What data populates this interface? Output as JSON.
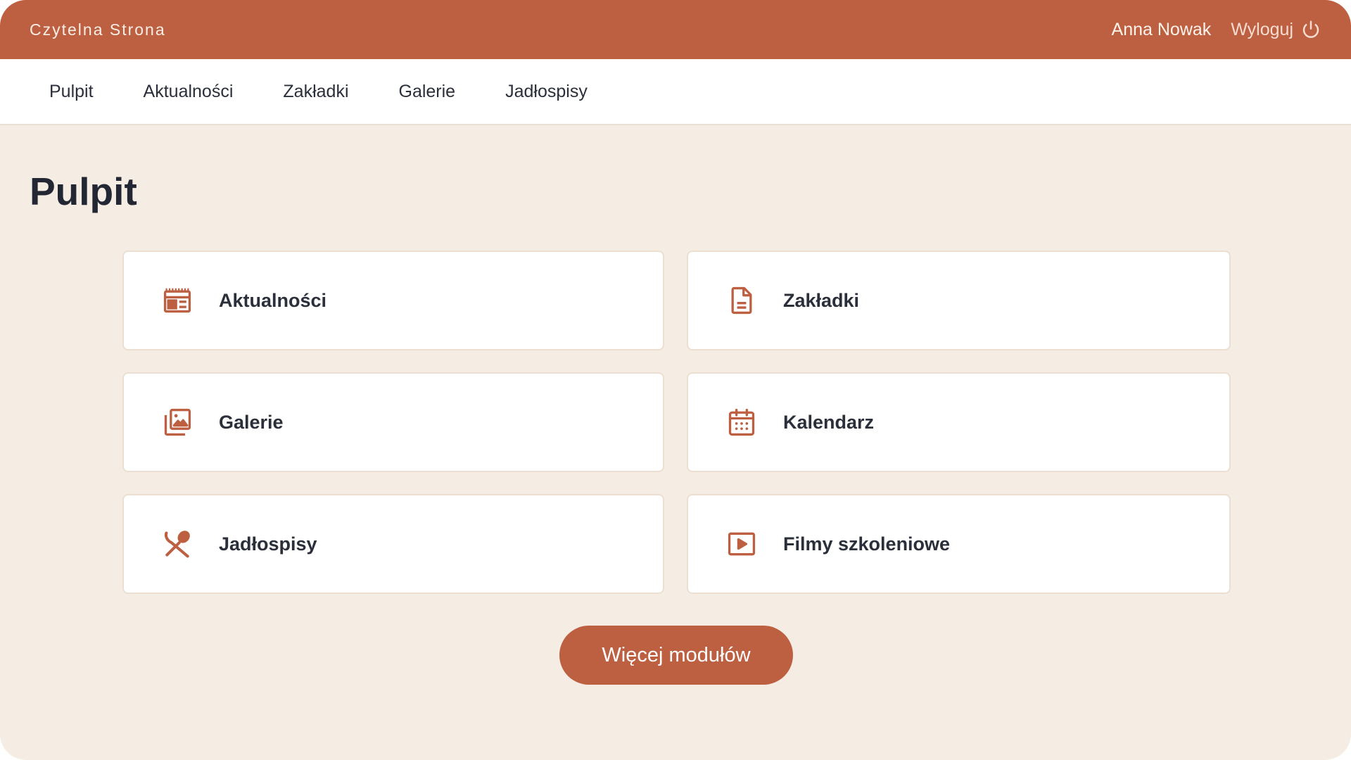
{
  "header": {
    "brand": "Czytelna Strona",
    "user_name": "Anna Nowak",
    "logout_label": "Wyloguj"
  },
  "nav": {
    "items": [
      "Pulpit",
      "Aktualności",
      "Zakładki",
      "Galerie",
      "Jadłospisy"
    ]
  },
  "main": {
    "title": "Pulpit",
    "modules": [
      {
        "label": "Aktualności",
        "icon": "newspaper-icon"
      },
      {
        "label": "Zakładki",
        "icon": "document-icon"
      },
      {
        "label": "Galerie",
        "icon": "gallery-icon"
      },
      {
        "label": "Kalendarz",
        "icon": "calendar-icon"
      },
      {
        "label": "Jadłospisy",
        "icon": "utensils-icon"
      },
      {
        "label": "Filmy szkoleniowe",
        "icon": "video-icon"
      }
    ],
    "more_button": "Więcej modułów"
  },
  "colors": {
    "accent": "#bd5f41",
    "background": "#f5ede3",
    "text": "#2b2f3a"
  }
}
